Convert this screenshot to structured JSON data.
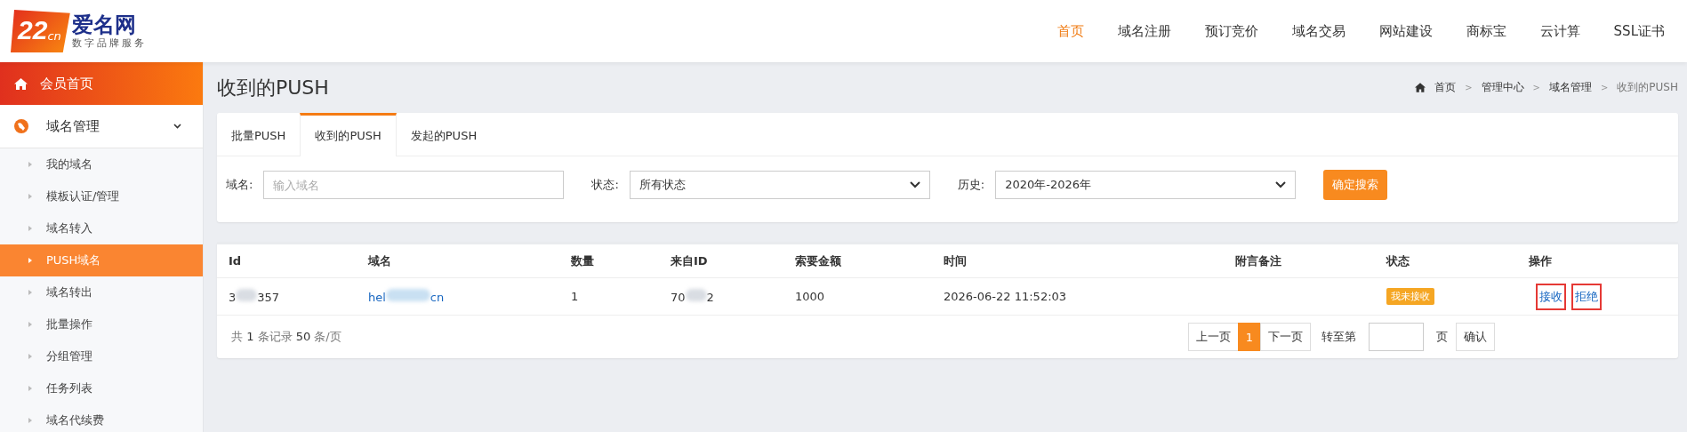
{
  "logo": {
    "mark": "22",
    "mark_suffix": "cn",
    "name": "爱名网",
    "slogan": "数字品牌服务"
  },
  "nav": [
    {
      "label": "首页",
      "selected": true
    },
    {
      "label": "域名注册",
      "selected": false
    },
    {
      "label": "预订竞价",
      "selected": false
    },
    {
      "label": "域名交易",
      "selected": false
    },
    {
      "label": "网站建设",
      "selected": false
    },
    {
      "label": "商标宝",
      "selected": false
    },
    {
      "label": "云计算",
      "selected": false
    },
    {
      "label": "SSL证书",
      "selected": false
    }
  ],
  "sidebar": {
    "home": "会员首页",
    "group": {
      "label": "域名管理",
      "expanded": true
    },
    "items": [
      {
        "label": "我的域名",
        "selected": false
      },
      {
        "label": "模板认证/管理",
        "selected": false
      },
      {
        "label": "域名转入",
        "selected": false
      },
      {
        "label": "PUSH域名",
        "selected": true
      },
      {
        "label": "域名转出",
        "selected": false
      },
      {
        "label": "批量操作",
        "selected": false
      },
      {
        "label": "分组管理",
        "selected": false
      },
      {
        "label": "任务列表",
        "selected": false
      },
      {
        "label": "域名代续费",
        "selected": false
      }
    ]
  },
  "page_title": "收到的PUSH",
  "breadcrumb": [
    "首页",
    "管理中心",
    "域名管理",
    "收到的PUSH"
  ],
  "breadcrumb_separator": ">",
  "tabs": [
    {
      "label": "批量PUSH",
      "selected": false
    },
    {
      "label": "收到的PUSH",
      "selected": true
    },
    {
      "label": "发起的PUSH",
      "selected": false
    }
  ],
  "filters": {
    "domain_label": "域名:",
    "domain_placeholder": "输入域名",
    "status_label": "状态:",
    "status_value": "所有状态",
    "history_label": "历史:",
    "history_value": "2020年-2026年",
    "search_button": "确定搜索"
  },
  "table": {
    "columns": [
      "Id",
      "域名",
      "数量",
      "来自ID",
      "索要金额",
      "时间",
      "附言备注",
      "状态",
      "操作"
    ],
    "rows": [
      {
        "id": {
          "before": "3",
          "after": "357"
        },
        "domain": {
          "before": "hel",
          "after": "cn"
        },
        "count": "1",
        "from_id": {
          "before": "70",
          "after": "2"
        },
        "amount": "1000",
        "time": "2026-06-22 11:52:03",
        "status": "我未接收",
        "actions": [
          {
            "label": "接收",
            "highlighted": true
          },
          {
            "label": "拒绝",
            "highlighted": true
          }
        ]
      }
    ]
  },
  "footer": {
    "summary": "共 **1** 条记录 **50** 条/页",
    "prev": "上一页",
    "pages": [
      {
        "label": "1",
        "selected": true
      }
    ],
    "next": "下一页",
    "goto_label": "转至第",
    "page_unit": "页",
    "confirm": "确认"
  }
}
